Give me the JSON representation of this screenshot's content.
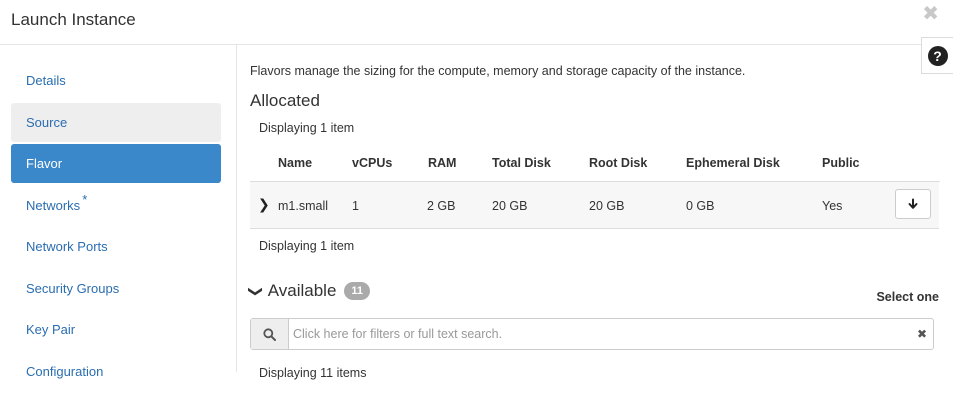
{
  "modal": {
    "title": "Launch Instance",
    "close_icon": "close-icon",
    "help_icon": "question-circle-icon"
  },
  "nav": {
    "items": [
      {
        "label": "Details",
        "state": "default"
      },
      {
        "label": "Source",
        "state": "visited"
      },
      {
        "label": "Flavor",
        "state": "active"
      },
      {
        "label": "Networks",
        "state": "default",
        "required_marker": "*"
      },
      {
        "label": "Network Ports",
        "state": "default"
      },
      {
        "label": "Security Groups",
        "state": "default"
      },
      {
        "label": "Key Pair",
        "state": "default"
      },
      {
        "label": "Configuration",
        "state": "default"
      }
    ]
  },
  "main": {
    "intro": "Flavors manage the sizing for the compute, memory and storage capacity of the instance.",
    "allocated": {
      "heading": "Allocated",
      "displaying_top": "Displaying 1 item",
      "displaying_bottom": "Displaying 1 item",
      "columns": [
        "Name",
        "vCPUs",
        "RAM",
        "Total Disk",
        "Root Disk",
        "Ephemeral Disk",
        "Public"
      ],
      "rows": [
        {
          "name": "m1.small",
          "vcpus": "1",
          "ram": "2 GB",
          "total_disk": "20 GB",
          "root_disk": "20 GB",
          "ephemeral_disk": "0 GB",
          "public": "Yes"
        }
      ],
      "expand_icon": "chevron-right-icon",
      "action_icon": "arrow-down-icon"
    },
    "available": {
      "heading": "Available",
      "count": "11",
      "toggle_icon": "chevron-down-icon",
      "select_hint": "Select one",
      "search_placeholder": "Click here for filters or full text search.",
      "search_icon": "search-icon",
      "clear_icon": "clear-icon",
      "displaying": "Displaying 11 items"
    }
  },
  "colors": {
    "accent": "#3a87c9",
    "link": "#2a6db0",
    "row_bg": "#f7f7f7",
    "badge": "#aaaaaa"
  }
}
